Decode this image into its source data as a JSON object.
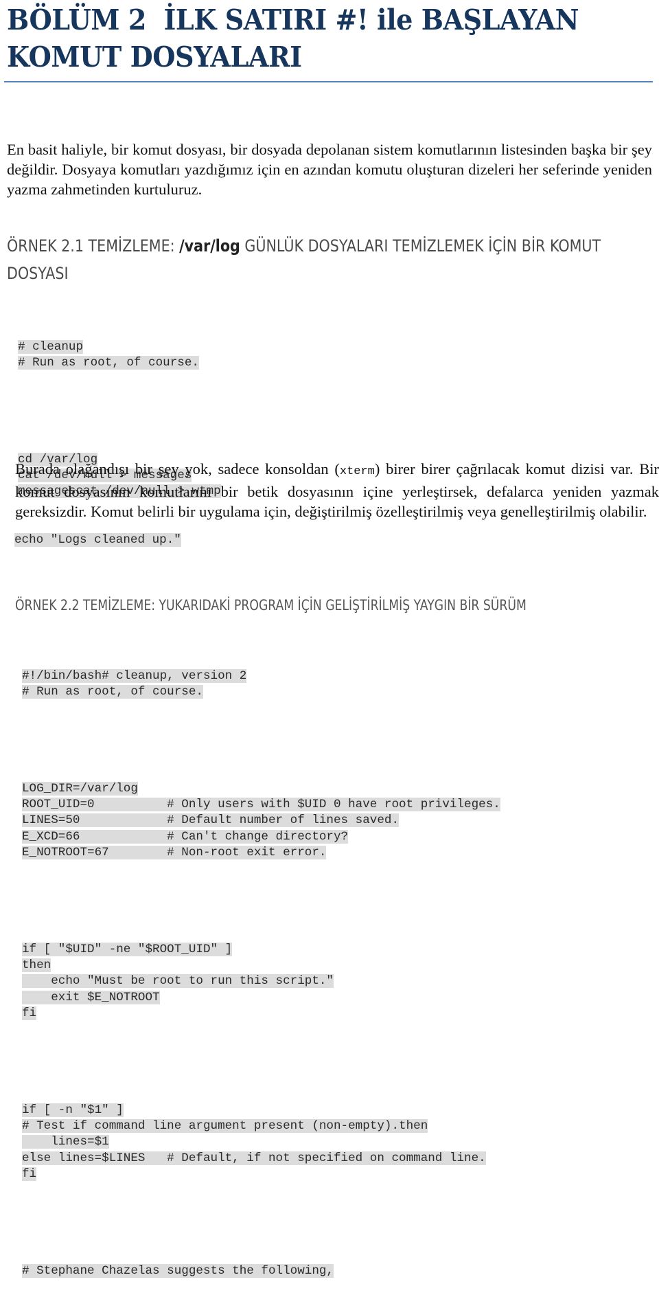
{
  "chapter": {
    "title_line1": "BÖLÜM 2  İLK SATIRI #! ile BAŞLAYAN",
    "title_line2": "KOMUT DOSYALARI"
  },
  "intro_paragraph": "En basit haliyle, bir komut dosyası, bir dosyada depolanan sistem komutlarının listesinden başka bir şey değildir. Dosyaya komutları yazdığımız için en azından komutu oluşturan dizeleri her seferinde yeniden yazma zahmetinden kurtuluruz.",
  "example1": {
    "heading_prefix": "ÖRNEK 2.1 TEMİZLEME: ",
    "heading_bold": "/var/log",
    "heading_suffix": " GÜNLÜK DOSYALARI TEMİZLEMEK İÇİN BİR KOMUT DOSYASI",
    "code_block_a": [
      "# cleanup",
      "# Run as root, of course."
    ],
    "code_block_b": [
      "cd /var/log",
      "cat /dev/null > messages",
      "messagescat /dev/null > wtmp"
    ],
    "code_last_line": "echo \"Logs cleaned up.\""
  },
  "explanation": {
    "before_code": "Burada olağandışı bir şey yok, sadece konsoldan (",
    "inline_code": "xterm",
    "after_code": ") birer birer çağrılacak komut dizisi var. Bir komut dosyasının komutlarını bir betik dosyasının içine yerleştirsek, defalarca yeniden yazmak gereksizdir. Komut belirli bir uygulama için, değiştirilmiş özelleştirilmiş veya genelleştirilmiş olabilir."
  },
  "example2": {
    "heading": "ÖRNEK 2.2 TEMİZLEME: YUKARIDAKİ PROGRAM İÇİN GELİŞTİRİLMİŞ YAYGIN BİR SÜRÜM",
    "block_header": [
      "#!/bin/bash# cleanup, version 2",
      "# Run as root, of course."
    ],
    "block_vars": [
      "LOG_DIR=/var/log",
      "ROOT_UID=0          # Only users with $UID 0 have root privileges.",
      "LINES=50            # Default number of lines saved.",
      "E_XCD=66            # Can't change directory?",
      "E_NOTROOT=67        # Non-root exit error."
    ],
    "block_if_root": [
      "if [ \"$UID\" -ne \"$ROOT_UID\" ]",
      "then",
      "    echo \"Must be root to run this script.\"",
      "    exit $E_NOTROOT",
      "fi"
    ],
    "block_args": [
      "if [ -n \"$1\" ]",
      "# Test if command line argument present (non-empty).then",
      "    lines=$1",
      "else lines=$LINES   # Default, if not specified on command line.",
      "fi"
    ],
    "block_tail": [
      "# Stephane Chazelas suggests the following,"
    ]
  }
}
